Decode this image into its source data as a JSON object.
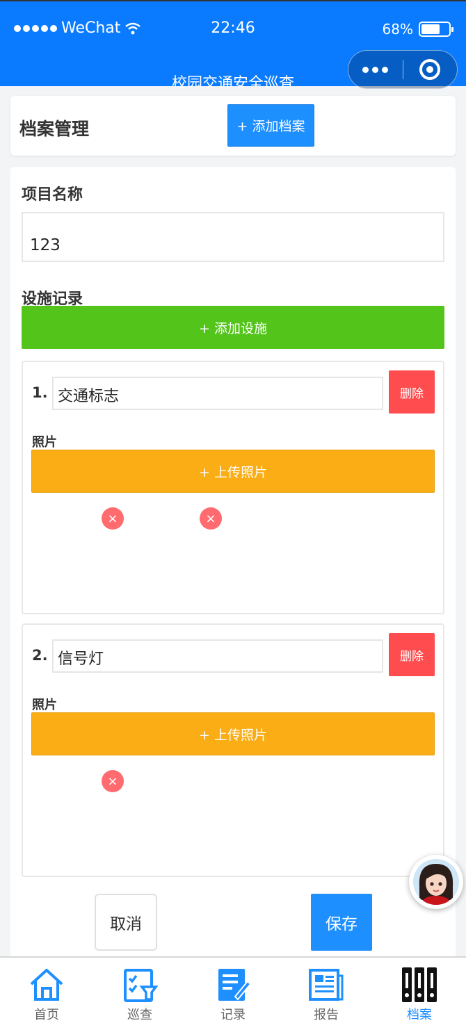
{
  "status_bar": {
    "carrier": "WeChat",
    "time": "22:46",
    "battery_percent": "68%",
    "battery_level": 0.68
  },
  "nav": {
    "title": "校园交通安全巡查"
  },
  "header": {
    "title": "档案管理",
    "add_archive_label": "+ 添加档案"
  },
  "form": {
    "project_label": "项目名称",
    "project_value": "123",
    "facility_label": "设施记录",
    "add_facility_label": "+ 添加设施",
    "facilities": [
      {
        "number": "1.",
        "name": "交通标志",
        "delete_label": "删除",
        "photo_label": "照片",
        "upload_label": "+ 上传照片",
        "remove_marks": [
          "×",
          "×"
        ]
      },
      {
        "number": "2.",
        "name": "信号灯",
        "delete_label": "删除",
        "photo_label": "照片",
        "upload_label": "+ 上传照片",
        "remove_marks": [
          "×"
        ]
      }
    ],
    "cancel_label": "取消",
    "save_label": "保存"
  },
  "tabbar": {
    "items": [
      {
        "label": "首页",
        "icon": "home-icon"
      },
      {
        "label": "巡查",
        "icon": "inspection-icon"
      },
      {
        "label": "记录",
        "icon": "record-icon"
      },
      {
        "label": "报告",
        "icon": "report-icon"
      },
      {
        "label": "档案",
        "icon": "archive-icon",
        "active": true
      }
    ]
  },
  "colors": {
    "primary": "#1e8fff",
    "success": "#52c41a",
    "warning": "#faad14",
    "danger": "#ff4d4f",
    "nav_bg": "#0a7bff"
  }
}
